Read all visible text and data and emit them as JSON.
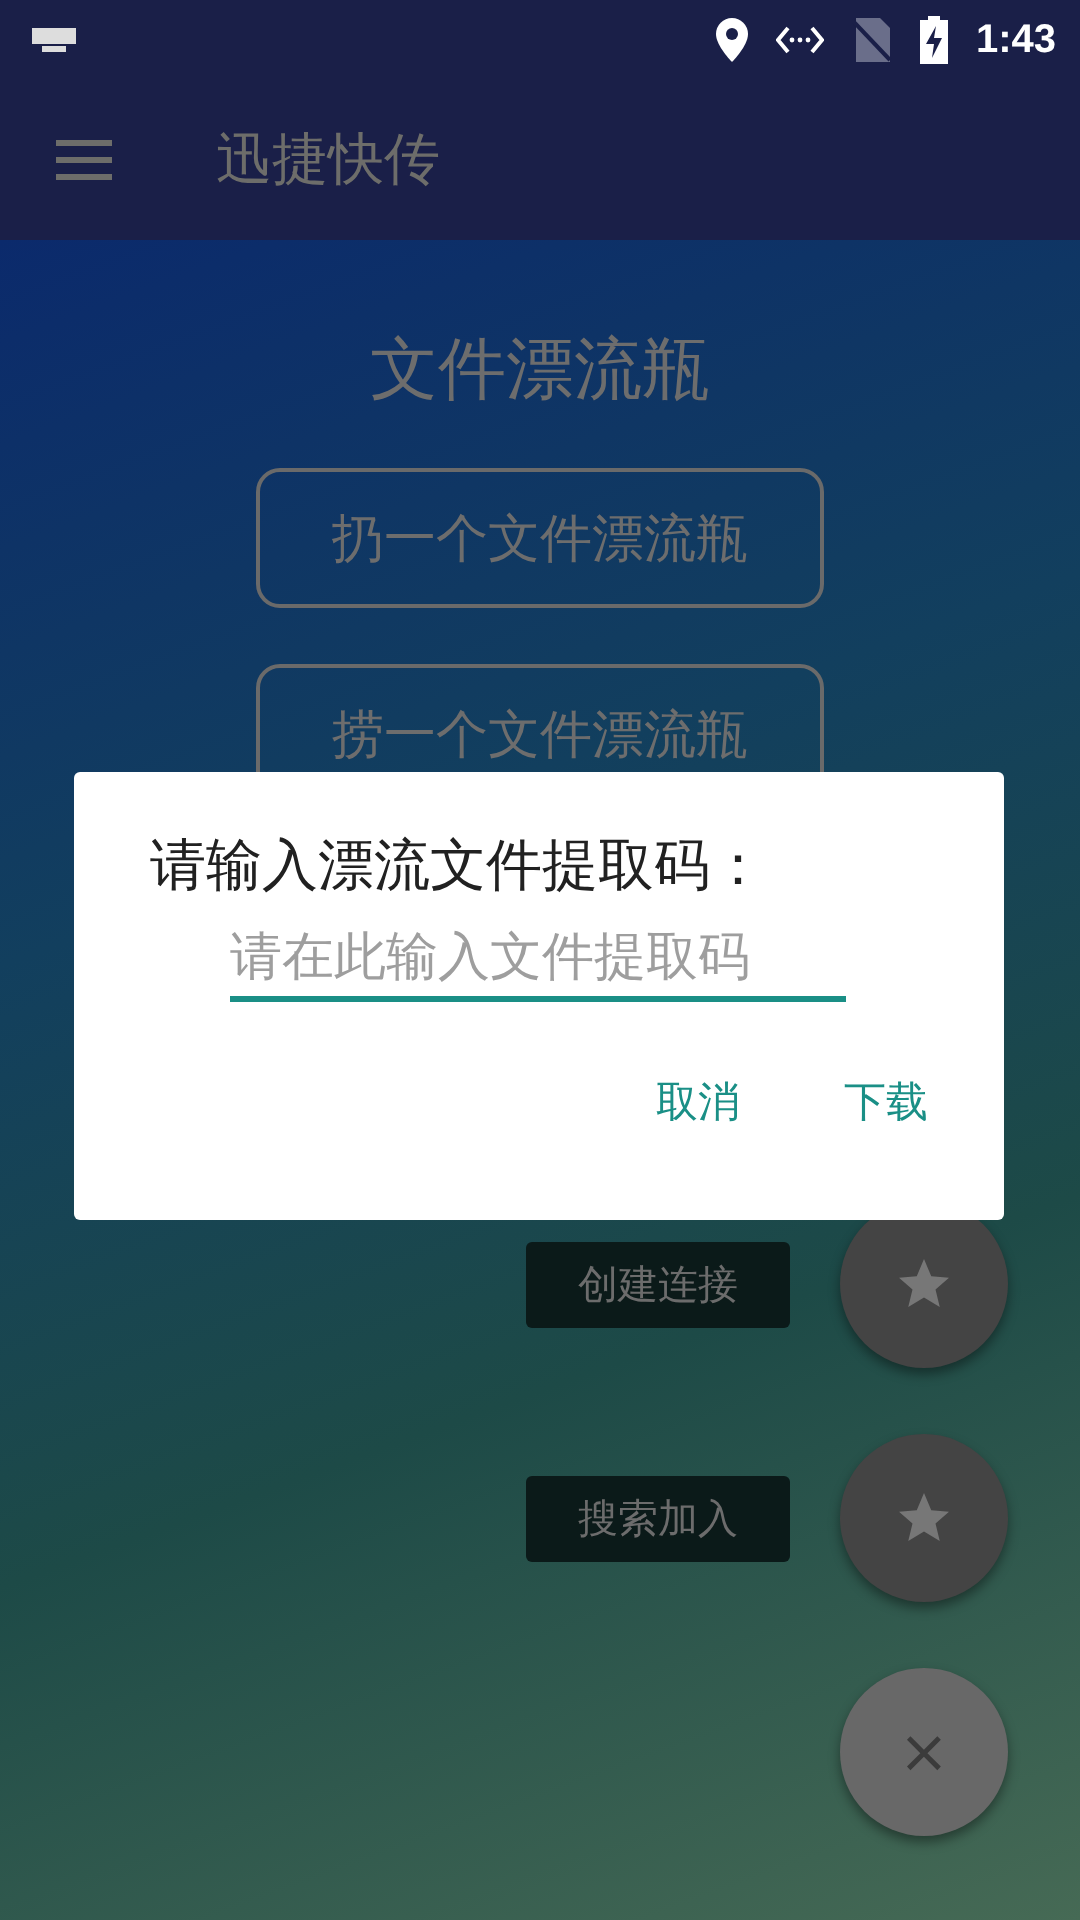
{
  "status_bar": {
    "time": "1:43"
  },
  "app_bar": {
    "title": "迅捷快传"
  },
  "content": {
    "title": "文件漂流瓶",
    "buttons": [
      "扔一个文件漂流瓶",
      "捞一个文件漂流瓶"
    ]
  },
  "dialog": {
    "title": "请输入漂流文件提取码：",
    "field": {
      "placeholder": "请在此输入文件提取码"
    },
    "buttons": [
      "取消",
      "下载"
    ]
  },
  "fab_menu": {
    "items": [
      {
        "label": "创建连接"
      },
      {
        "label": "搜索加入"
      }
    ],
    "close": "×"
  }
}
